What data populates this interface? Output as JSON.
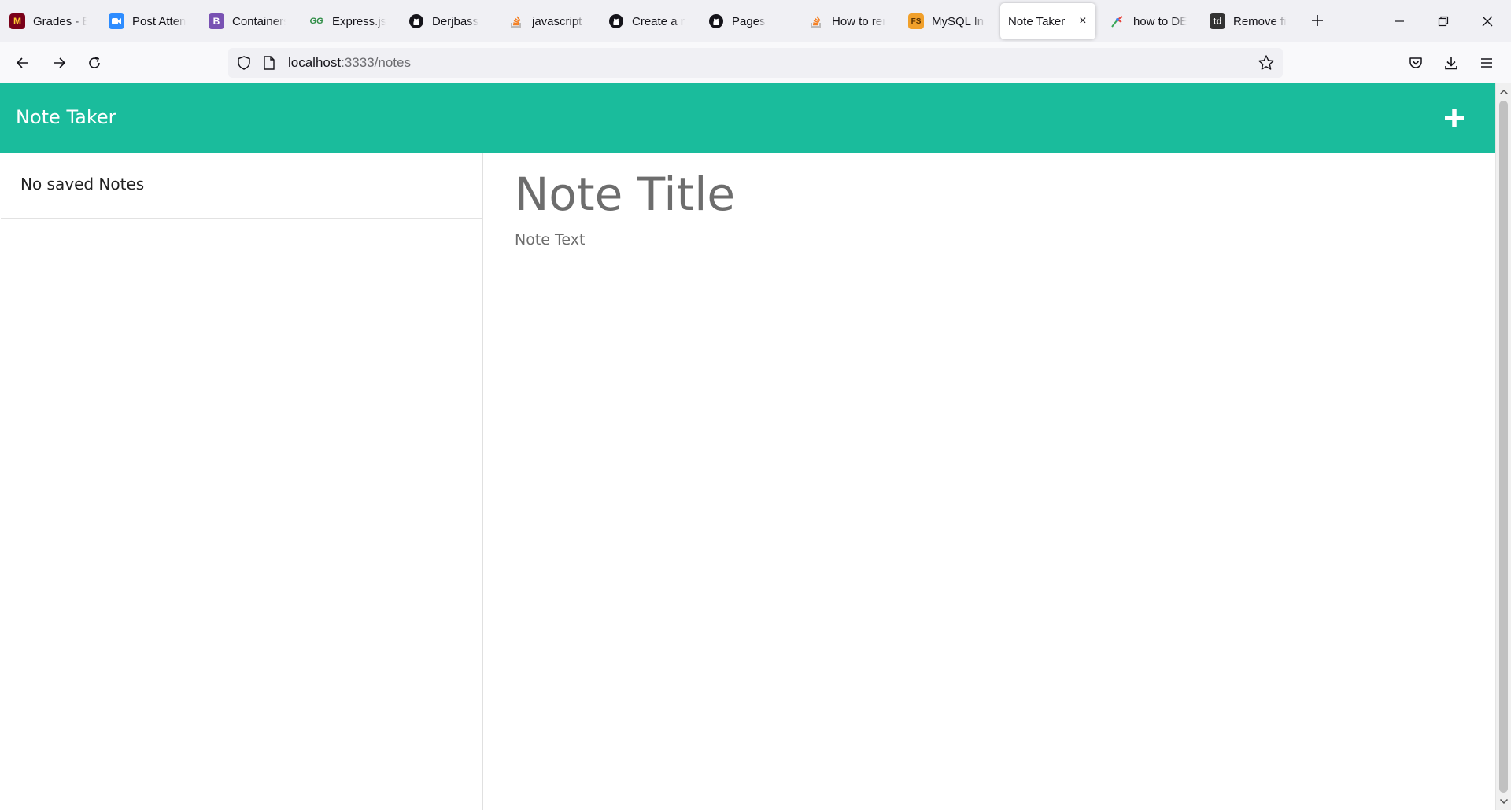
{
  "browser": {
    "tabs": [
      {
        "label": "Grades - B",
        "icon": "umn-logo-icon",
        "color": "#ffcc33"
      },
      {
        "label": "Post Attenc",
        "icon": "zoom-icon",
        "color": "#2d8cff"
      },
      {
        "label": "Containers",
        "icon": "bootstrap-icon",
        "color": "#7952b3"
      },
      {
        "label": "Express.js |",
        "icon": "geeksforgeeks-icon",
        "color": "#2f8d46"
      },
      {
        "label": "Derjbass",
        "icon": "github-icon",
        "color": "#15141a"
      },
      {
        "label": "javascript -",
        "icon": "stackoverflow-icon",
        "color": "#f48024"
      },
      {
        "label": "Create a ne",
        "icon": "github-icon",
        "color": "#15141a"
      },
      {
        "label": "Pages",
        "icon": "github-icon",
        "color": "#15141a"
      },
      {
        "label": "How to ren",
        "icon": "stackoverflow-icon",
        "color": "#f48024"
      },
      {
        "label": "MySQL Inst",
        "icon": "freecodecamp-icon",
        "color": "#f1a02a"
      },
      {
        "label": "Note Taker",
        "icon": "",
        "color": "",
        "active": true
      },
      {
        "label": "how to DEL",
        "icon": "tool-icon",
        "color": "#3aa757"
      },
      {
        "label": "Remove fir",
        "icon": "td-logo-icon",
        "color": "#333333"
      }
    ],
    "close_tab_glyph": "×",
    "new_tab_icon": "plus-icon",
    "url": {
      "host": "localhost",
      "rest": ":3333/notes"
    }
  },
  "app": {
    "brand": "Note Taker",
    "accent": "#1abc9c",
    "add_icon": "plus-icon"
  },
  "notes_list": {
    "empty_message": "No saved Notes"
  },
  "editor": {
    "title_placeholder": "Note Title",
    "text_placeholder": "Note Text"
  }
}
